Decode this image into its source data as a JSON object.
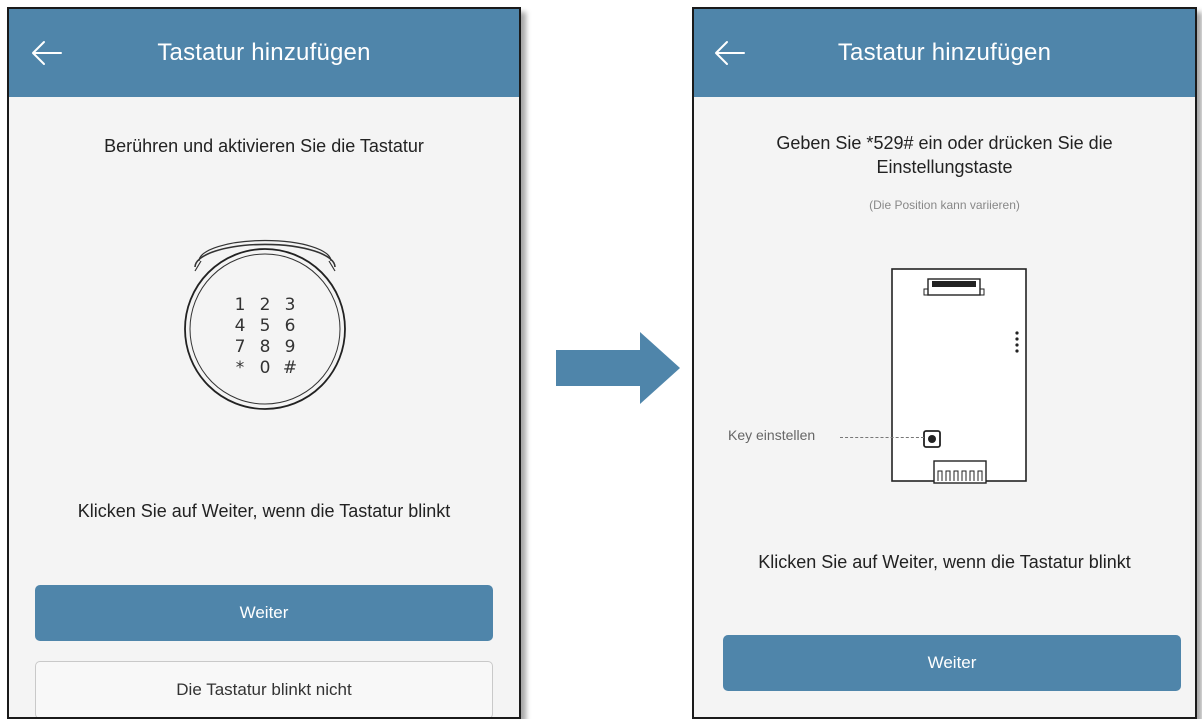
{
  "left": {
    "title": "Tastatur hinzufügen",
    "instruction": "Berühren und aktivieren Sie die Tastatur",
    "keypad_keys": [
      "1",
      "2",
      "3",
      "4",
      "5",
      "6",
      "7",
      "8",
      "9",
      "*",
      "0",
      "#"
    ],
    "hint": "Klicken Sie auf Weiter, wenn die Tastatur blinkt",
    "next_label": "Weiter",
    "not_blinking_label": "Die Tastatur blinkt nicht"
  },
  "right": {
    "title": "Tastatur hinzufügen",
    "instruction_line1": "Geben Sie *529# ein oder drücken Sie die",
    "instruction_line2": "Einstellungstaste",
    "note": "(Die Position kann variieren)",
    "key_label": "Key einstellen",
    "hint": "Klicken Sie auf Weiter, wenn die Tastatur blinkt",
    "next_label": "Weiter"
  },
  "colors": {
    "header": "#4f85aa",
    "arrow": "#4f85aa",
    "background": "#f4f4f4"
  },
  "icons": {
    "back": "arrow-left",
    "transition": "arrow-right"
  }
}
